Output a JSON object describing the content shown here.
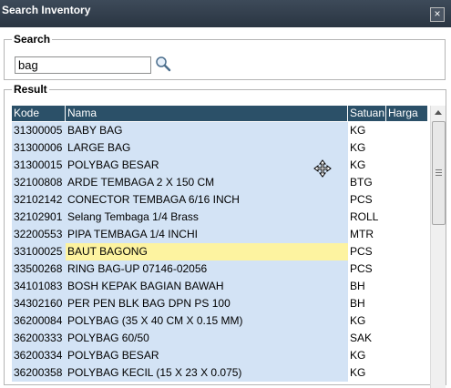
{
  "window": {
    "title": "Search Inventory",
    "close_label": "×"
  },
  "search": {
    "legend": "Search",
    "value": "bag"
  },
  "result": {
    "legend": "Result",
    "columns": [
      "Kode",
      "Nama",
      "Satuan",
      "Harga"
    ],
    "rows": [
      {
        "kode": "31300005",
        "nama": "BABY BAG",
        "satuan": "KG"
      },
      {
        "kode": "31300006",
        "nama": "LARGE BAG",
        "satuan": "KG"
      },
      {
        "kode": "31300015",
        "nama": "POLYBAG BESAR",
        "satuan": "KG"
      },
      {
        "kode": "32100808",
        "nama": "ARDE TEMBAGA 2 X 150 CM",
        "satuan": "BTG"
      },
      {
        "kode": "32102142",
        "nama": "CONECTOR TEMBAGA 6/16 INCH",
        "satuan": "PCS"
      },
      {
        "kode": "32102901",
        "nama": "Selang Tembaga 1/4 Brass",
        "satuan": "ROLL"
      },
      {
        "kode": "32200553",
        "nama": "PIPA TEMBAGA 1/4 INCHI",
        "satuan": "MTR"
      },
      {
        "kode": "33100025",
        "nama": "BAUT BAGONG",
        "satuan": "PCS"
      },
      {
        "kode": "33500268",
        "nama": "RING BAG-UP 07146-02056",
        "satuan": "PCS"
      },
      {
        "kode": "34101083",
        "nama": "BOSH KEPAK BAGIAN BAWAH",
        "satuan": "BH"
      },
      {
        "kode": "34302160",
        "nama": "PER PEN BLK BAG DPN PS 100",
        "satuan": "BH"
      },
      {
        "kode": "36200084",
        "nama": "POLYBAG (35 X 40 CM X 0.15 MM)",
        "satuan": "KG"
      },
      {
        "kode": "36200333",
        "nama": "POLYBAG 60/50",
        "satuan": "SAK"
      },
      {
        "kode": "36200334",
        "nama": "POLYBAG BESAR",
        "satuan": "KG"
      },
      {
        "kode": "36200358",
        "nama": "POLYBAG KECIL (15 X 23 X 0.075)",
        "satuan": "KG"
      }
    ],
    "highlighted_row": 7
  },
  "colors": {
    "titlebar": "#2f3a47",
    "header": "#2b5068",
    "row": "#d3e3f5",
    "highlight": "#fdf3a0"
  }
}
